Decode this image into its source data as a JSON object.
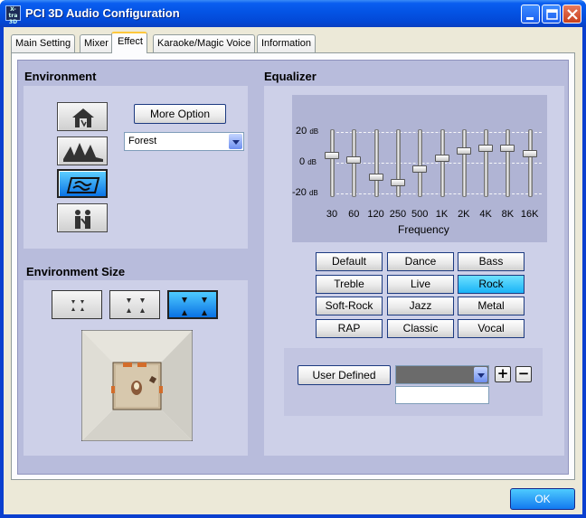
{
  "window": {
    "title": "PCI 3D Audio Configuration",
    "icon_text": "X-tra 3D"
  },
  "tabs": [
    {
      "label": "Main Setting"
    },
    {
      "label": "Mixer"
    },
    {
      "label": "Effect",
      "active": true
    },
    {
      "label": "Karaoke/Magic Voice"
    },
    {
      "label": "Information"
    }
  ],
  "environment": {
    "heading": "Environment",
    "buttons": [
      {
        "icon": "house-icon"
      },
      {
        "icon": "opera-house-icon"
      },
      {
        "icon": "forest-icon",
        "selected": true
      },
      {
        "icon": "people-icon"
      }
    ],
    "more_option_label": "More Option",
    "selected_environment": "Forest"
  },
  "environment_size": {
    "heading": "Environment Size",
    "sizes": [
      {
        "icon": "small-room-icon"
      },
      {
        "icon": "medium-room-icon"
      },
      {
        "icon": "large-room-icon",
        "selected": true
      }
    ]
  },
  "equalizer": {
    "heading": "Equalizer",
    "db_labels": [
      "20",
      "0",
      "-20"
    ],
    "db_unit": "dB",
    "frequency_label": "Frequency",
    "bands": [
      {
        "freq": "30",
        "gain": 5
      },
      {
        "freq": "60",
        "gain": 2
      },
      {
        "freq": "120",
        "gain": -9
      },
      {
        "freq": "250",
        "gain": -13
      },
      {
        "freq": "500",
        "gain": -4
      },
      {
        "freq": "1K",
        "gain": 3
      },
      {
        "freq": "2K",
        "gain": 8
      },
      {
        "freq": "4K",
        "gain": 10
      },
      {
        "freq": "8K",
        "gain": 10
      },
      {
        "freq": "16K",
        "gain": 6
      }
    ],
    "presets": [
      {
        "label": "Default"
      },
      {
        "label": "Dance"
      },
      {
        "label": "Bass"
      },
      {
        "label": "Treble"
      },
      {
        "label": "Live"
      },
      {
        "label": "Rock",
        "selected": true
      },
      {
        "label": "Soft-Rock"
      },
      {
        "label": "Jazz"
      },
      {
        "label": "Metal"
      },
      {
        "label": "RAP"
      },
      {
        "label": "Classic"
      },
      {
        "label": "Vocal"
      }
    ],
    "user_defined_label": "User  Defined",
    "user_defined_selected": "",
    "user_defined_name": "",
    "add_label": "+",
    "remove_label": "−"
  },
  "footer": {
    "ok_label": "OK"
  },
  "colors": {
    "title_bar": "#0453e4",
    "selected": "#19b3f7",
    "panel": "#b8bcdc"
  }
}
